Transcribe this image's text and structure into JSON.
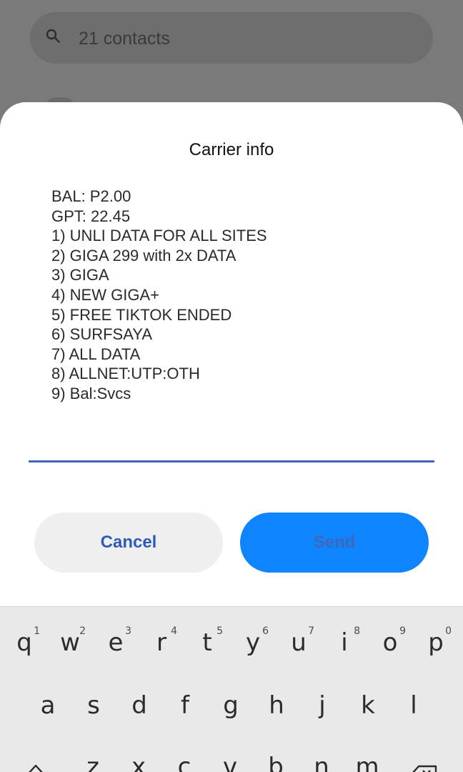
{
  "background": {
    "search": {
      "text": "21 contacts",
      "icon": "search-icon"
    }
  },
  "dialog": {
    "title": "Carrier info",
    "message_lines": [
      "BAL: P2.00",
      "GPT: 22.45",
      "1) UNLI DATA FOR ALL SITES",
      "2) GIGA 299 with 2x DATA",
      "3) GIGA",
      "4) NEW GIGA+",
      "5) FREE TIKTOK ENDED",
      "6) SURFSAYA",
      "7) ALL DATA",
      "8) ALLNET:UTP:OTH",
      "9) Bal:Svcs"
    ],
    "reply_value": "",
    "cancel_label": "Cancel",
    "send_label": "Send"
  },
  "keyboard": {
    "row1": [
      {
        "key": "q",
        "hint": "1"
      },
      {
        "key": "w",
        "hint": "2"
      },
      {
        "key": "e",
        "hint": "3"
      },
      {
        "key": "r",
        "hint": "4"
      },
      {
        "key": "t",
        "hint": "5"
      },
      {
        "key": "y",
        "hint": "6"
      },
      {
        "key": "u",
        "hint": "7"
      },
      {
        "key": "i",
        "hint": "8"
      },
      {
        "key": "o",
        "hint": "9"
      },
      {
        "key": "p",
        "hint": "0"
      }
    ],
    "row2": [
      "a",
      "s",
      "d",
      "f",
      "g",
      "h",
      "j",
      "k",
      "l"
    ],
    "row3": [
      "z",
      "x",
      "c",
      "v",
      "b",
      "n",
      "m"
    ],
    "shift_icon": "shift-arrow-icon",
    "backspace_icon": "backspace-icon"
  },
  "colors": {
    "accent": "#0f84ff",
    "link": "#2f5bb8",
    "underline": "#3f66b8",
    "overlay": "#7a7a7a"
  }
}
